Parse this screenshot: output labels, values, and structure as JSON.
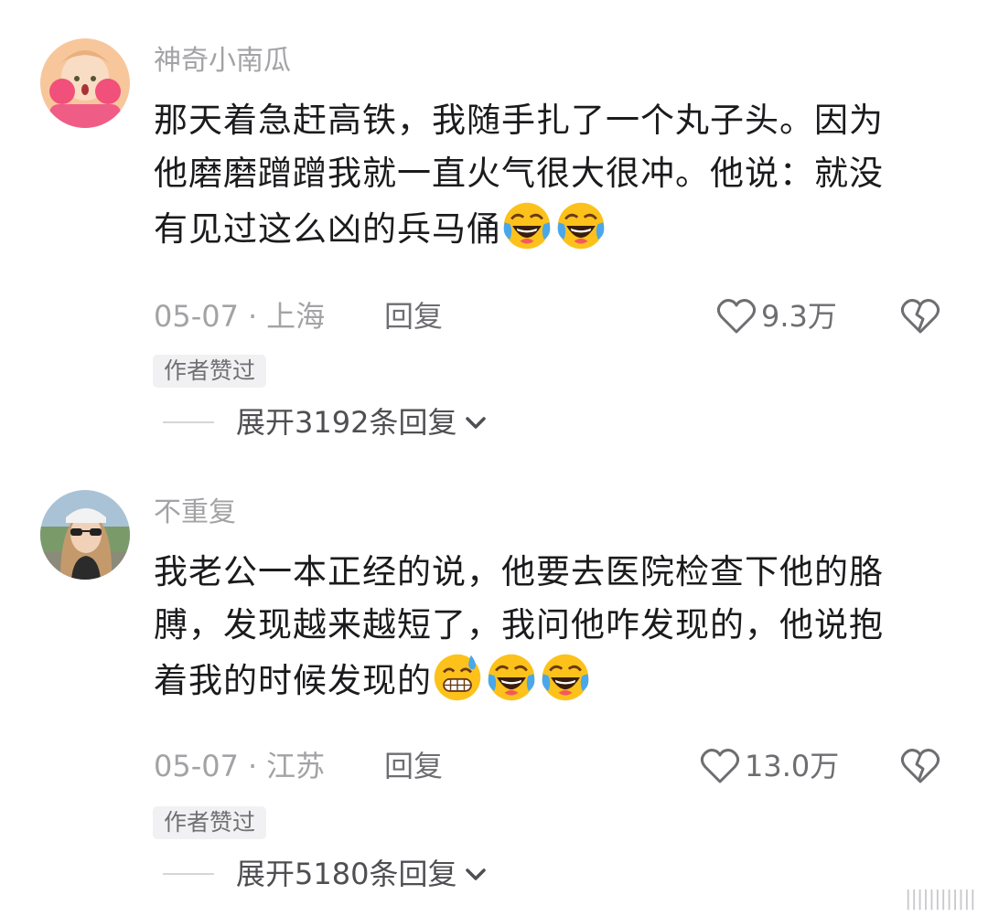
{
  "comments": [
    {
      "username": "神奇小南瓜",
      "body_lines": [
        "那天着急赶高铁，我随手扎了一个丸子头。因为",
        "他磨磨蹭蹭我就一直火气很大很冲。他说：就没",
        "有见过这么凶的兵马俑"
      ],
      "emojis": [
        "laughing-crying-emoji",
        "laughing-crying-emoji"
      ],
      "date": "05-07",
      "separator": "·",
      "location": "上海",
      "reply_label": "回复",
      "like_count": "9.3万",
      "badge": "作者赞过",
      "expand_label": "展开3192条回复"
    },
    {
      "username": "不重复",
      "body_lines": [
        "我老公一本正经的说，他要去医院检查下他的胳",
        "膊，发现越来越短了，我问他咋发现的，他说抱",
        "着我的时候发现的"
      ],
      "emojis": [
        "grinning-sweat-emoji",
        "laughing-crying-emoji",
        "laughing-crying-emoji"
      ],
      "date": "05-07",
      "separator": "·",
      "location": "江苏",
      "reply_label": "回复",
      "like_count": "13.0万",
      "badge": "作者赞过",
      "expand_label": "展开5180条回复"
    }
  ],
  "watermark": "||||||||||||",
  "icons": {
    "like": "heart-outline-icon",
    "dislike": "broken-heart-icon",
    "expand": "chevron-down-icon"
  },
  "colors": {
    "username": "#a3a3a6",
    "body": "#1b1b1d",
    "badge_bg": "#f1f1f3",
    "emoji_face": "#fcc21b"
  }
}
